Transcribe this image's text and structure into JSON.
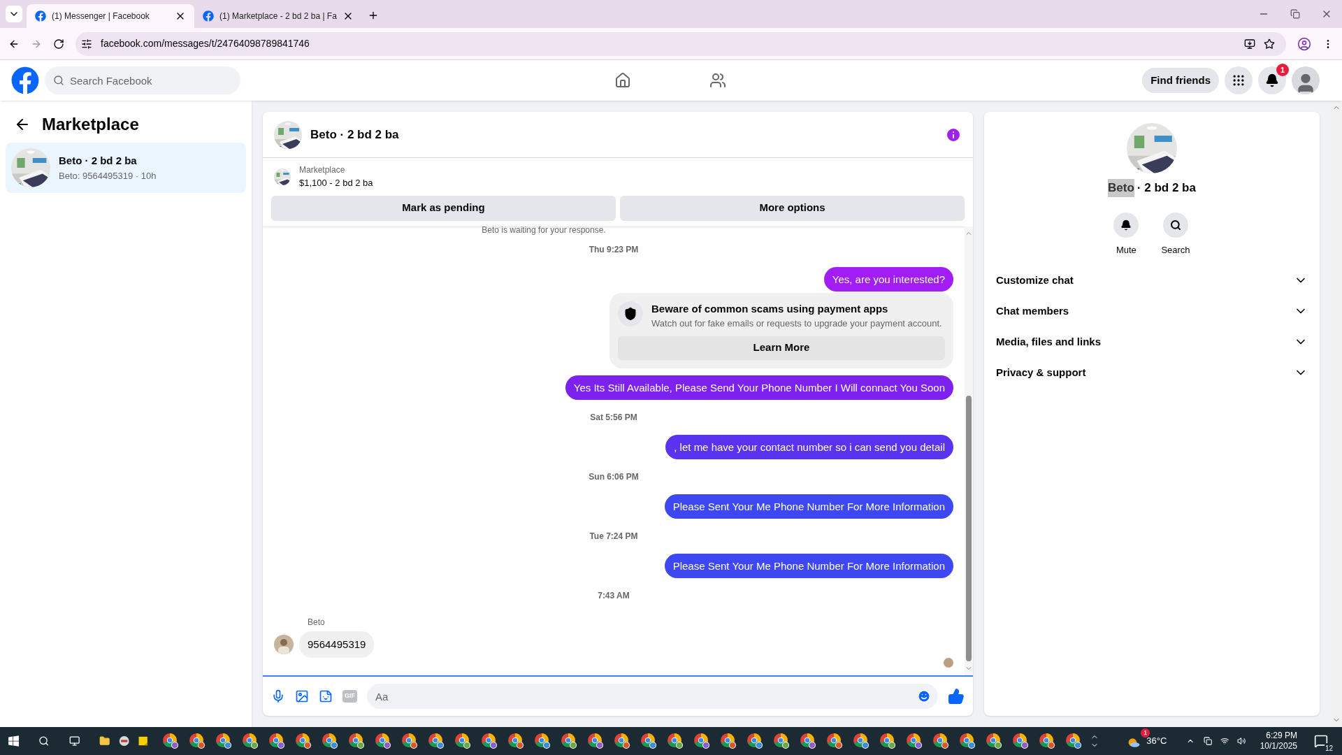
{
  "browser": {
    "tabs": [
      {
        "title": "(1) Messenger | Facebook",
        "selected": true
      },
      {
        "title": "(1) Marketplace - 2 bd 2 ba | Fa",
        "selected": false
      }
    ],
    "url": "facebook.com/messages/t/24764098789841746"
  },
  "header": {
    "search_placeholder": "Search Facebook",
    "find_friends": "Find friends",
    "notification_count": "1"
  },
  "sidebar": {
    "title": "Marketplace",
    "conversations": [
      {
        "name": "Beto · 2 bd 2 ba",
        "preview": "Beto: 9564495319 · 10h",
        "selected": true
      }
    ]
  },
  "chat": {
    "title": "Beto · 2 bd 2 ba",
    "listing": {
      "label": "Marketplace",
      "price": "$1,100 - 2 bd 2 ba"
    },
    "actions": [
      "Mark as pending",
      "More options"
    ],
    "messages": [
      {
        "kind": "notice",
        "text": "Beto is waiting for your response."
      },
      {
        "kind": "time",
        "text": "Thu 9:23 PM"
      },
      {
        "kind": "sent",
        "text": "Yes, are you interested?",
        "color": "#a11cf5"
      },
      {
        "kind": "warning",
        "title": "Beware of common scams using payment apps",
        "body": "Watch out for fake emails or requests to upgrade your payment account.",
        "button": "Learn More"
      },
      {
        "kind": "sent",
        "text": "Yes Its Still Available, Please Send Your Phone Number I Will connact You Soon",
        "color": "#7d22ee"
      },
      {
        "kind": "time",
        "text": "Sat 5:56 PM"
      },
      {
        "kind": "sent",
        "text": ", let me have your contact number so i can send you detail",
        "color": "#5a33f0"
      },
      {
        "kind": "time",
        "text": "Sun 6:06 PM"
      },
      {
        "kind": "sent",
        "text": "Please Sent Your Me Phone Number For More Information",
        "color": "#3d47f2"
      },
      {
        "kind": "time",
        "text": "Tue 7:24 PM"
      },
      {
        "kind": "sent",
        "text": "Please Sent Your Me Phone Number For More Information",
        "color": "#3d47f2"
      },
      {
        "kind": "time",
        "text": "7:43 AM"
      },
      {
        "kind": "received",
        "sender": "Beto",
        "text": "9564495319"
      }
    ],
    "composer": {
      "placeholder": "Aa",
      "gif": "GIF"
    }
  },
  "details": {
    "name_selected": "Beto",
    "name_rest": "· 2 bd 2 ba",
    "actions": [
      "Mute",
      "Search"
    ],
    "sections": [
      {
        "label": "Customize chat",
        "expanded": false
      },
      {
        "label": "Chat members",
        "expanded": false
      },
      {
        "label": "Media, files and links",
        "expanded": false
      },
      {
        "label": "Privacy & support",
        "expanded": false
      }
    ]
  },
  "taskbar": {
    "weather_badge": "1",
    "temperature": "36°C",
    "time": "6:29 PM",
    "date": "10/1/2025",
    "notification_count": "12"
  }
}
